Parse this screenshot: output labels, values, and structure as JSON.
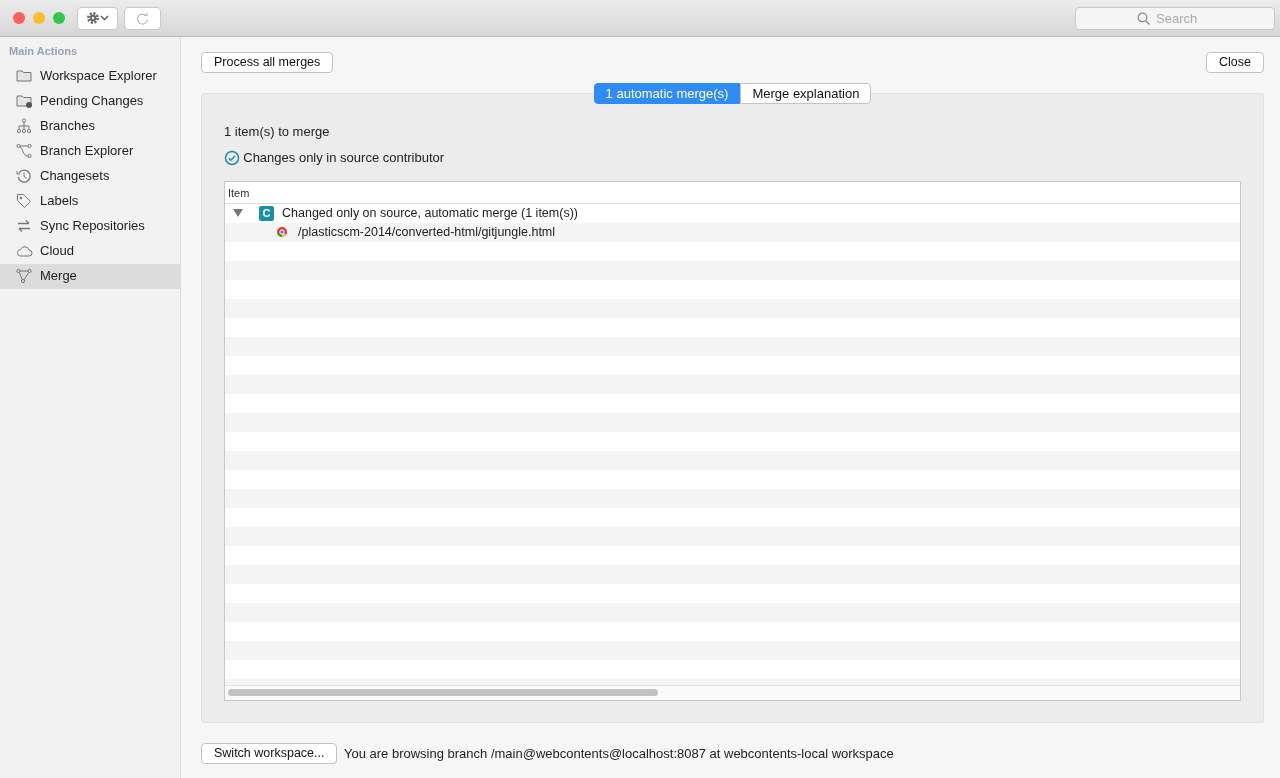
{
  "toolbar": {
    "search": {
      "placeholder": "Search"
    }
  },
  "sidebar": {
    "heading": "Main Actions",
    "items": [
      {
        "label": "Workspace Explorer",
        "kind": "folder",
        "selected": false
      },
      {
        "label": "Pending Changes",
        "kind": "pending",
        "selected": false
      },
      {
        "label": "Branches",
        "kind": "branches",
        "selected": false
      },
      {
        "label": "Branch Explorer",
        "kind": "explorer",
        "selected": false
      },
      {
        "label": "Changesets",
        "kind": "history",
        "selected": false
      },
      {
        "label": "Labels",
        "kind": "tag",
        "selected": false
      },
      {
        "label": "Sync Repositories",
        "kind": "sync",
        "selected": false
      },
      {
        "label": "Cloud",
        "kind": "cloud",
        "selected": false
      },
      {
        "label": "Merge",
        "kind": "merge",
        "selected": true
      }
    ]
  },
  "actions": {
    "process": "Process all merges",
    "close": "Close"
  },
  "tabs": [
    {
      "label": "1 automatic merge(s)",
      "selected": true
    },
    {
      "label": "Merge explanation",
      "selected": false
    }
  ],
  "summary": "1 item(s) to merge",
  "filter": {
    "label": "Changes only in source contributor",
    "checked": true
  },
  "table": {
    "columns": [
      "Item"
    ],
    "rows": [
      {
        "badge": "C",
        "label": "Changed only on source, automatic merge (1 item(s))",
        "expanded": true,
        "children": [
          {
            "label": "/plasticscm-2014/converted-html/gitjungle.html"
          }
        ]
      }
    ]
  },
  "footer": {
    "button": "Switch workspace...",
    "status": "You are browsing branch /main@webcontents@localhost:8087 at webcontents-local workspace"
  }
}
